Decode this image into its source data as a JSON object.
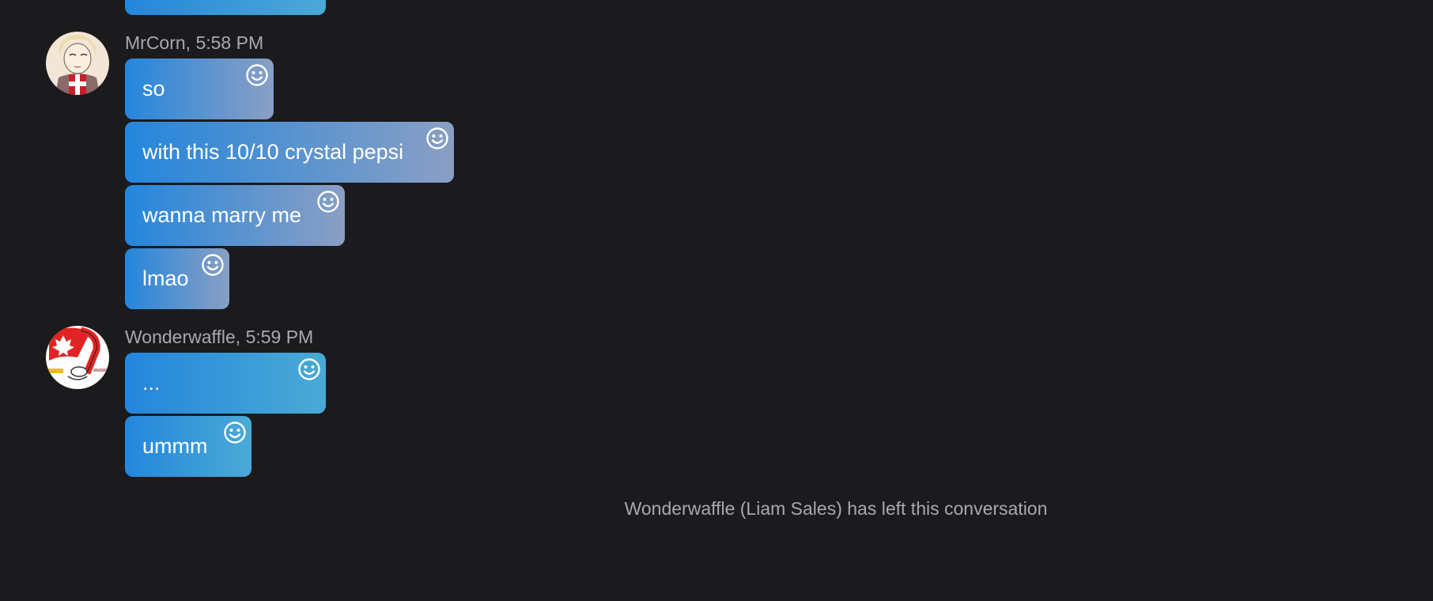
{
  "messages": [
    {
      "sender": "MrCorn, 5:58 PM",
      "avatar_icon": "danish-character-avatar",
      "bubbles": [
        "so",
        "with this 10/10 crystal pepsi",
        "wanna marry me",
        "lmao"
      ]
    },
    {
      "sender": "Wonderwaffle, 5:59 PM",
      "avatar_icon": "canada-flag-avatar",
      "bubbles": [
        "...",
        "ummm"
      ]
    }
  ],
  "system_notice": "Wonderwaffle (Liam Sales) has left this conversation",
  "reaction_icon": "smiley-icon",
  "colors": {
    "background": "#1b1b1d",
    "bubble_start": "#2486dc",
    "bubble_end_group1": "#8a9fc4",
    "bubble_end_group2": "#4aaad6",
    "meta_text": "#a9a9ad"
  }
}
